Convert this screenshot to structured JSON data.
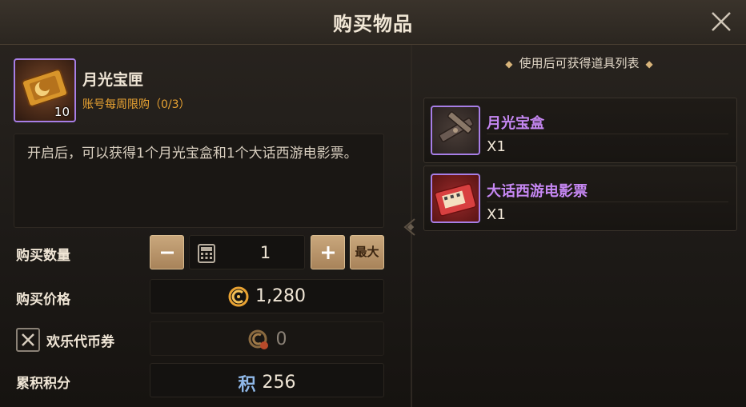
{
  "dialog": {
    "title": "购买物品",
    "close_icon": "close-icon"
  },
  "item": {
    "name": "月光宝匣",
    "count": "10",
    "limit": "账号每周限购（0/3）",
    "description": "开启后，可以获得1个月光宝盒和1个大话西游电影票。"
  },
  "purchase": {
    "quantity_label": "购买数量",
    "quantity_value": "1",
    "max_label": "最大",
    "price_label": "购买价格",
    "price_value": "1,280",
    "coupon_label": "欢乐代币券",
    "coupon_value": "0",
    "points_label": "累积积分",
    "points_icon_text": "积",
    "points_value": "256"
  },
  "rewards": {
    "header": "使用后可获得道具列表",
    "header_dot": "◆",
    "items": [
      {
        "name": "月光宝盒",
        "qty": "X1"
      },
      {
        "name": "大话西游电影票",
        "qty": "X1"
      }
    ]
  },
  "colors": {
    "accent_purple": "#a77ee6",
    "reward_name": "#c587f2",
    "limit_orange": "#e8a232",
    "button_tan": "#c9a77c"
  }
}
